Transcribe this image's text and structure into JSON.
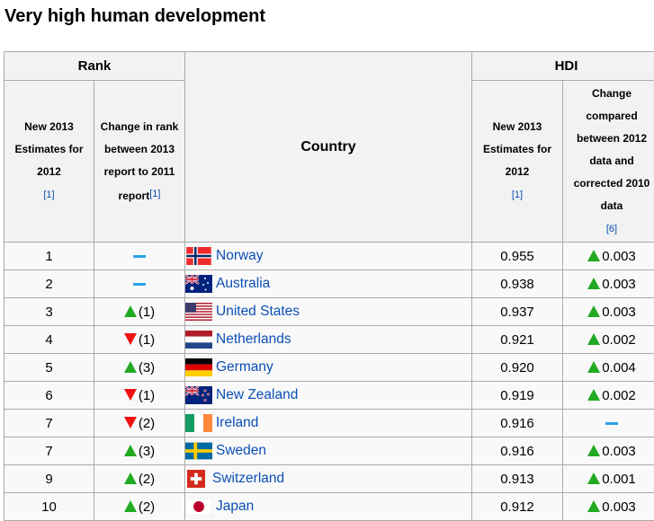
{
  "title": "Very high human development",
  "headers": {
    "rank": "Rank",
    "hdi": "HDI",
    "country": "Country",
    "new_estimates_lines": [
      "New 2013",
      "Estimates for",
      "2012"
    ],
    "change_rank_lines": [
      "Change in rank",
      "between 2013",
      "report to 2011",
      "report"
    ],
    "change_hdi_lines": [
      "Change",
      "compared",
      "between 2012",
      "data and",
      "corrected 2010",
      "data"
    ],
    "ref1": "[1]",
    "ref6": "[6]"
  },
  "rows": [
    {
      "rank": "1",
      "change_dir": "same",
      "change": "",
      "country": "Norway",
      "flag": "norway",
      "hdi": "0.955",
      "hdi_dir": "up",
      "hdi_change": "0.003"
    },
    {
      "rank": "2",
      "change_dir": "same",
      "change": "",
      "country": "Australia",
      "flag": "australia",
      "hdi": "0.938",
      "hdi_dir": "up",
      "hdi_change": "0.003"
    },
    {
      "rank": "3",
      "change_dir": "up",
      "change": "(1)",
      "country": "United States",
      "flag": "usa",
      "hdi": "0.937",
      "hdi_dir": "up",
      "hdi_change": "0.003"
    },
    {
      "rank": "4",
      "change_dir": "down",
      "change": "(1)",
      "country": "Netherlands",
      "flag": "netherlands",
      "hdi": "0.921",
      "hdi_dir": "up",
      "hdi_change": "0.002"
    },
    {
      "rank": "5",
      "change_dir": "up",
      "change": "(3)",
      "country": "Germany",
      "flag": "germany",
      "hdi": "0.920",
      "hdi_dir": "up",
      "hdi_change": "0.004"
    },
    {
      "rank": "6",
      "change_dir": "down",
      "change": "(1)",
      "country": "New Zealand",
      "flag": "newzealand",
      "hdi": "0.919",
      "hdi_dir": "up",
      "hdi_change": "0.002"
    },
    {
      "rank": "7",
      "change_dir": "down",
      "change": "(2)",
      "country": "Ireland",
      "flag": "ireland",
      "hdi": "0.916",
      "hdi_dir": "same",
      "hdi_change": ""
    },
    {
      "rank": "7",
      "change_dir": "up",
      "change": "(3)",
      "country": "Sweden",
      "flag": "sweden",
      "hdi": "0.916",
      "hdi_dir": "up",
      "hdi_change": "0.003"
    },
    {
      "rank": "9",
      "change_dir": "up",
      "change": "(2)",
      "country": "Switzerland",
      "flag": "switzerland",
      "hdi": "0.913",
      "hdi_dir": "up",
      "hdi_change": "0.001"
    },
    {
      "rank": "10",
      "change_dir": "up",
      "change": "(2)",
      "country": "Japan",
      "flag": "japan",
      "hdi": "0.912",
      "hdi_dir": "up",
      "hdi_change": "0.003"
    }
  ]
}
